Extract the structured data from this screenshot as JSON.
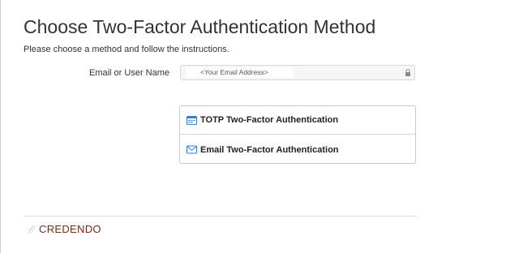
{
  "page": {
    "title": "Choose Two-Factor Authentication Method",
    "subtitle": "Please choose a method and follow the instructions."
  },
  "email": {
    "label": "Email or User Name",
    "value": "<Your Email Address>",
    "lock_icon": "lock-icon"
  },
  "methods": [
    {
      "label": "TOTP Two-Factor Authentication",
      "icon": "totp-icon"
    },
    {
      "label": "Email Two-Factor Authentication",
      "icon": "envelope-icon"
    }
  ],
  "footer": {
    "logo_text": "CREDENDO"
  },
  "colors": {
    "accent": "#3a7bd5",
    "brand": "#7a2a1e"
  }
}
